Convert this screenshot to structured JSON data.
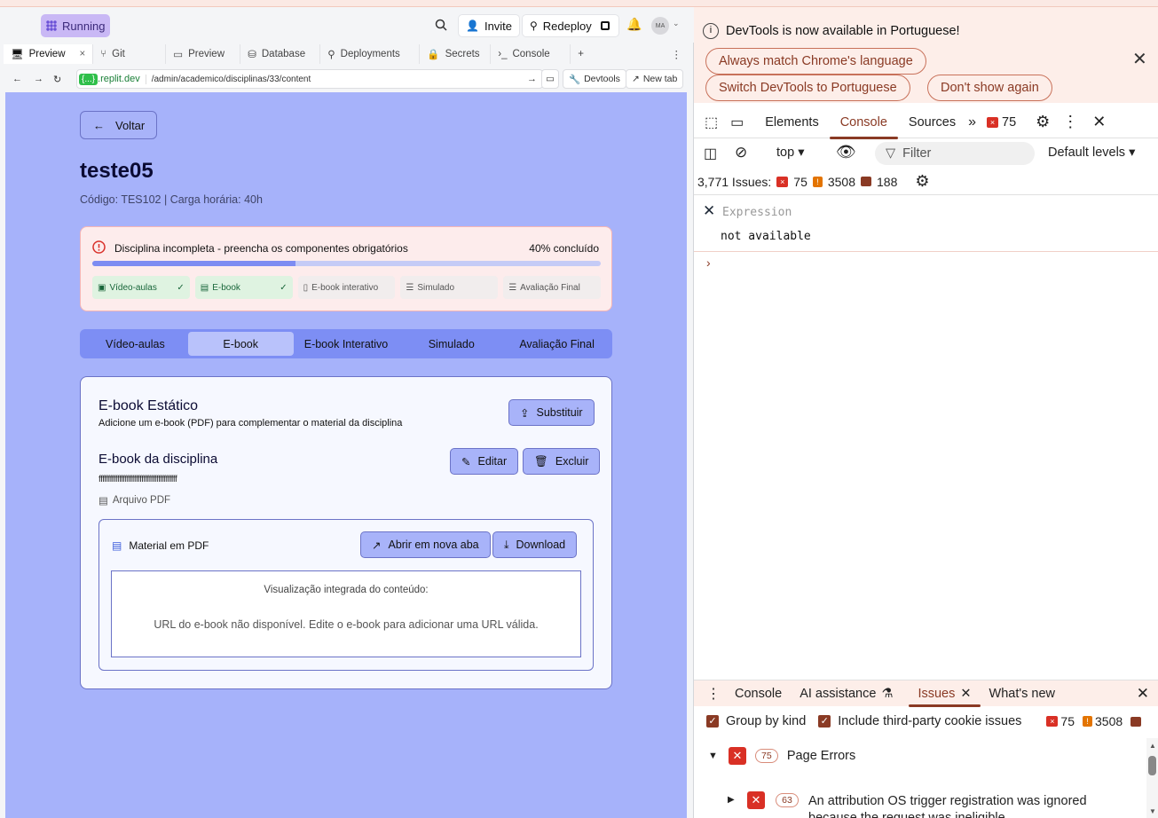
{
  "replit": {
    "status": "Running",
    "invite": "Invite",
    "redeploy": "Redeploy",
    "avatar_initials": "MA",
    "tabs": [
      {
        "label": "Preview",
        "icon": "monitor-icon",
        "active": true
      },
      {
        "label": "Git",
        "icon": "git-icon"
      },
      {
        "label": "Preview",
        "icon": "monitor-icon"
      },
      {
        "label": "Database",
        "icon": "database-icon"
      },
      {
        "label": "Deployments",
        "icon": "deploy-icon"
      },
      {
        "label": "Secrets",
        "icon": "lock-icon"
      },
      {
        "label": "Console",
        "icon": "terminal-icon"
      }
    ],
    "url": {
      "host_badge": "{...}",
      "host": ".replit.dev",
      "path": "/admin/academico/disciplinas/33/content",
      "devtools": "Devtools",
      "new_tab": "New tab"
    }
  },
  "app": {
    "back": "Voltar",
    "title": "teste05",
    "subtitle": "Código: TES102 | Carga horária: 40h",
    "alert": {
      "message": "Disciplina incompleta - preencha os componentes obrigatórios",
      "percent_label": "40% concluído",
      "progress": 0.4,
      "chips": [
        {
          "label": "Vídeo-aulas",
          "done": true
        },
        {
          "label": "E-book",
          "done": true
        },
        {
          "label": "E-book interativo",
          "done": false
        },
        {
          "label": "Simulado",
          "done": false
        },
        {
          "label": "Avaliação Final",
          "done": false
        }
      ]
    },
    "tabs": [
      "Vídeo-aulas",
      "E-book",
      "E-book Interativo",
      "Simulado",
      "Avaliação Final"
    ],
    "active_tab": "E-book",
    "card": {
      "title": "E-book Estático",
      "description": "Adicione um e-book (PDF) para complementar o material da disciplina",
      "replace": "Substituir",
      "ebook_title": "E-book da disciplina",
      "ebook_sub": "ffffffffffffffffffffffffffffffffffffffffff",
      "file_type": "Arquivo PDF",
      "edit": "Editar",
      "delete": "Excluir",
      "pdf_label": "Material em PDF",
      "open_new": "Abrir em nova aba",
      "download": "Download",
      "viewer_title": "Visualização integrada do conteúdo:",
      "viewer_msg": "URL do e-book não disponível. Edite o e-book para adicionar uma URL válida."
    }
  },
  "devtools": {
    "banner": "DevTools is now available in Portuguese!",
    "btn_match": "Always match Chrome's language",
    "btn_switch": "Switch DevTools to Portuguese",
    "btn_dont": "Don't show again",
    "tabs": [
      "Elements",
      "Console",
      "Sources"
    ],
    "error_count": "75",
    "context": "top",
    "filter": "Filter",
    "levels": "Default levels",
    "issues_label": "3,771 Issues:",
    "issues_errors": "75",
    "issues_warnings": "3508",
    "issues_info": "188",
    "expression": "Expression",
    "expression_value": "not available",
    "drawer_tabs": [
      "Console",
      "AI assistance",
      "Issues",
      "What's new"
    ],
    "group_by_kind": "Group by kind",
    "third_party": "Include third-party cookie issues",
    "opt_errors": "75",
    "opt_warnings": "3508",
    "group_count": "75",
    "group_title": "Page Errors",
    "item_count": "63",
    "item_text": "An attribution OS trigger registration was ignored because the request was ineligible"
  }
}
